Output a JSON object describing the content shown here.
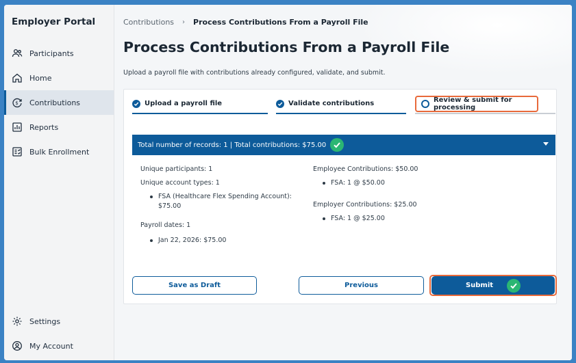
{
  "sidebar": {
    "brand": "Employer Portal",
    "items": [
      {
        "label": "Participants",
        "icon": "participants-icon"
      },
      {
        "label": "Home",
        "icon": "home-icon"
      },
      {
        "label": "Contributions",
        "icon": "contributions-icon",
        "active": true
      },
      {
        "label": "Reports",
        "icon": "reports-icon"
      },
      {
        "label": "Bulk Enrollment",
        "icon": "bulk-enrollment-icon"
      }
    ],
    "bottom": [
      {
        "label": "Settings",
        "icon": "gear-icon"
      },
      {
        "label": "My Account",
        "icon": "account-icon"
      }
    ]
  },
  "breadcrumb": {
    "parent": "Contributions",
    "separator": "›",
    "current": "Process Contributions From a Payroll File"
  },
  "page": {
    "title": "Process Contributions From a Payroll File",
    "subtitle": "Upload a payroll file with contributions already configured, validate, and submit."
  },
  "steps": [
    {
      "label": "Upload a payroll file",
      "status": "complete"
    },
    {
      "label": "Validate contributions",
      "status": "complete"
    },
    {
      "label": "Review & submit for processing",
      "status": "current"
    }
  ],
  "summary": {
    "header": "Total number of records: 1 | Total contributions: $75.00",
    "left": {
      "unique_participants": "Unique participants: 1",
      "unique_account_types": "Unique account types: 1",
      "account_type_item_1": "FSA (Healthcare Flex Spending Account):",
      "account_type_item_2": "$75.00",
      "payroll_dates": "Payroll dates: 1",
      "payroll_date_item": "Jan 22, 2026: $75.00"
    },
    "right": {
      "employee_contributions": "Employee Contributions: $50.00",
      "employee_item": "FSA: 1 @ $50.00",
      "employer_contributions": "Employer Contributions: $25.00",
      "employer_item": "FSA: 1 @ $25.00"
    }
  },
  "buttons": {
    "save_draft": "Save as Draft",
    "previous": "Previous",
    "submit": "Submit"
  },
  "colors": {
    "primary": "#0d5b9a",
    "highlight": "#e8693a",
    "success": "#2bb673"
  }
}
